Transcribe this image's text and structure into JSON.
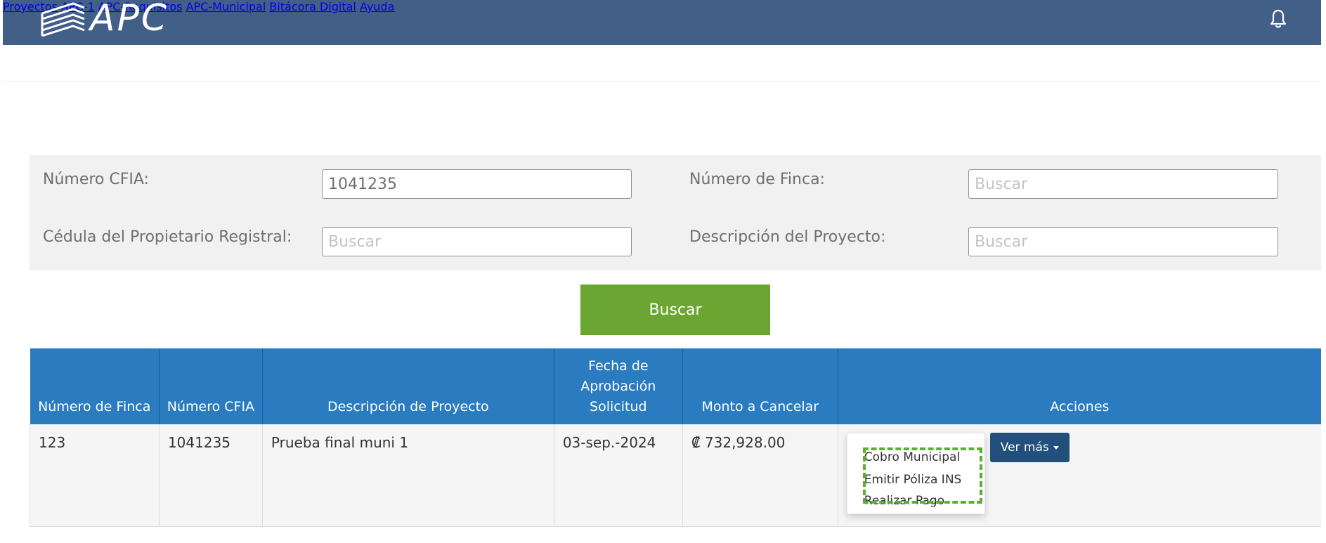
{
  "header": {
    "logo_text": "APC",
    "nav": [
      {
        "label": "Proyectos"
      },
      {
        "label": "APC-1"
      },
      {
        "label": "APC-Requisitos"
      },
      {
        "label": "APC-Municipal"
      },
      {
        "label": "Bitácora Digital"
      },
      {
        "label": "Ayuda"
      }
    ],
    "bell_icon": "bell-icon",
    "bg_color": "#415f87"
  },
  "search": {
    "cfia_label": "Número CFIA:",
    "cfia_value": "1041235",
    "finca_label": "Número de Finca:",
    "finca_placeholder": "Buscar",
    "cedula_label": "Cédula del Propietario Registral:",
    "cedula_placeholder": "Buscar",
    "descripcion_label": "Descripción del Proyecto:",
    "descripcion_placeholder": "Buscar",
    "button_label": "Buscar",
    "button_color": "#6aa631"
  },
  "table": {
    "columns": [
      {
        "label": "Número de Finca"
      },
      {
        "label": "Número CFIA"
      },
      {
        "label": "Descripción de Proyecto"
      },
      {
        "label": "Fecha de Aprobación Solicitud"
      },
      {
        "label": "Monto a Cancelar"
      },
      {
        "label": "Acciones"
      }
    ],
    "header_color": "#2a7bbf",
    "rows": [
      {
        "finca": "123",
        "cfia": "1041235",
        "descripcion": "Prueba final muni 1",
        "fecha": "03-sep.-2024",
        "monto": "₡ 732,928.00",
        "actions": {
          "menu": [
            "Cobro Municipal",
            "Emitir Póliza INS",
            "Realizar Pago"
          ],
          "ver_mas_label": "Ver más"
        }
      }
    ]
  }
}
